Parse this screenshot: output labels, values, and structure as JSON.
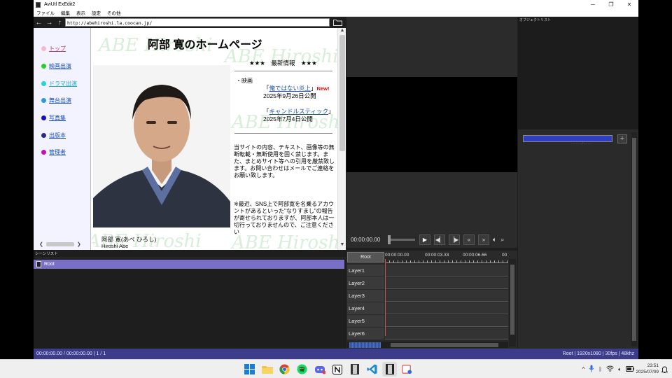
{
  "window": {
    "title": "AviUtl ExEdit2",
    "minimize_glyph": "─",
    "maximize_glyph": "❐",
    "close_glyph": "✕"
  },
  "menu": [
    "ファイル",
    "編集",
    "表示",
    "設定",
    "その他"
  ],
  "browser": {
    "url": "http://abehiroshi.la.coocan.jp/",
    "back_glyph": "←",
    "forward_glyph": "→",
    "up_glyph": "↑"
  },
  "site": {
    "watermark": "ABE Hiroshi",
    "title": "阿部 寛のホームページ",
    "nav": [
      {
        "label": "トップ",
        "dot": "#f5b8c6",
        "color": "#b23a6a"
      },
      {
        "label": "映画出演",
        "dot": "#22d422",
        "color": "#1a50b8"
      },
      {
        "label": "ドラマ出演",
        "dot": "#22d4d4",
        "color": "#1aa6c8"
      },
      {
        "label": "舞台出演",
        "dot": "#2a9ae0",
        "color": "#1a50b8"
      },
      {
        "label": "写真集",
        "dot": "#1010c8",
        "color": "#1a50b8"
      },
      {
        "label": "出版本",
        "dot": "#2a2a8a",
        "color": "#1a50b8"
      },
      {
        "label": "管理者",
        "dot": "#c010c0",
        "color": "#1a50b8"
      }
    ],
    "news_heading": "★★★　最新情報　★★★",
    "news_category": "・映画",
    "movies": [
      {
        "title": "俺ではない炎上",
        "open_bracket": "「",
        "close_bracket": "」",
        "new_tag": "New!",
        "date": "2025年9月26日公開"
      },
      {
        "title": "キャンドルスティック",
        "open_bracket": "「",
        "close_bracket": "」",
        "new_tag": "",
        "date": "2025年7月4日公開"
      }
    ],
    "notice": "当サイトの内容、テキスト、画像等の無断転載・無断使用を固く禁じます。また、まとめサイト等への引用を厳禁致します。お問い合わせはメールでご連絡をお願い致します。",
    "notice2": "※最近、SNS上で阿部寛を名乗るアカウントがあるといった\"なりすまし\"の報告が寄せられておりますが、阿部本人は一切行っておりませんので、ご注意ください",
    "caption_name": "阿部 寛(あべ ひろし)",
    "caption_romaji": "Hiroshi Abe"
  },
  "scene_list": {
    "header": "シーンリスト",
    "items": [
      "Root"
    ]
  },
  "status": {
    "left": "00:00:00.00 / 00:00:00.00  |  1 / 1",
    "right": "Root  |  1920x1080  |  30fps  |  48khz"
  },
  "preview": {
    "timecode": "00:00:00.00"
  },
  "timeline": {
    "root_label": "Root",
    "ticks": [
      "00:00:00.00",
      "00:00:03.33",
      "00:00:06.66",
      "00"
    ],
    "layers": [
      "Layer1",
      "Layer2",
      "Layer3",
      "Layer4",
      "Layer5",
      "Layer6"
    ]
  },
  "object_list": {
    "header": "オブジェクトリスト"
  },
  "properties": {
    "add_label": "+",
    "subtext": "- - - - - / - - - -"
  },
  "taskbar": {
    "clock_time": "23:51",
    "clock_date": "2025/07/09"
  },
  "colors": {
    "status_bar": "#3c3c8a",
    "scene_selected": "#7a6fc7",
    "playhead": "#d05050"
  }
}
